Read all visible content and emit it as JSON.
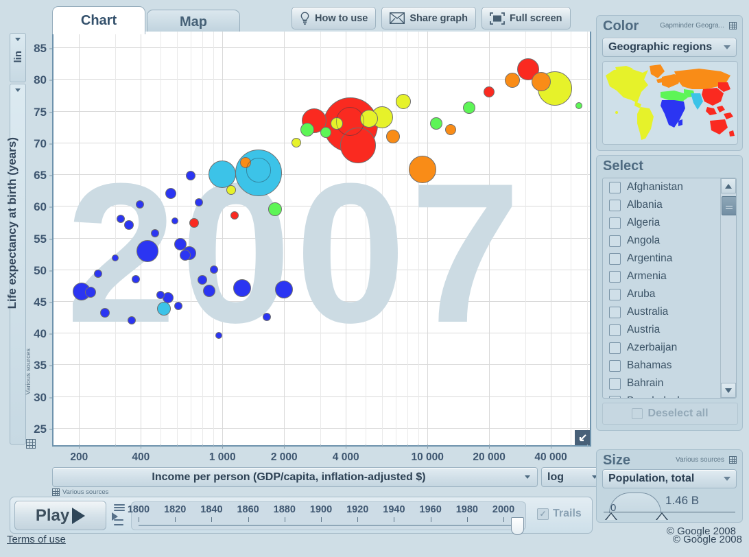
{
  "tabs": [
    {
      "label": "Chart",
      "active": true
    },
    {
      "label": "Map",
      "active": false
    }
  ],
  "toolbar": {
    "how_to_use": "How to use",
    "share_graph": "Share graph",
    "full_screen": "Full screen"
  },
  "chart_data": {
    "type": "scatter",
    "title": "2007",
    "watermark_year": "2007",
    "xlabel": "Income per person (GDP/capita, inflation-adjusted $)",
    "ylabel": "Life expectancy at birth (years)",
    "x_scale": "log",
    "y_scale": "lin",
    "x_tick_labels": [
      "200",
      "400",
      "1 000",
      "2 000",
      "4 000",
      "10 000",
      "20 000",
      "40 000"
    ],
    "x_tick_values": [
      200,
      400,
      1000,
      2000,
      4000,
      10000,
      20000,
      40000
    ],
    "y_tick_labels": [
      "85",
      "80",
      "75",
      "70",
      "65",
      "60",
      "55",
      "50",
      "45",
      "40",
      "35",
      "30",
      "25"
    ],
    "y_tick_values": [
      85,
      80,
      75,
      70,
      65,
      60,
      55,
      50,
      45,
      40,
      35,
      30,
      25
    ],
    "xlim": [
      150,
      62000
    ],
    "ylim": [
      22.5,
      87.5
    ],
    "grid": true,
    "legend": "none",
    "size_variable": "Population, total",
    "color_variable": "Geographic regions",
    "series": [
      {
        "name": "Sub-Saharan Africa",
        "color": "#2b35f2"
      },
      {
        "name": "South Asia",
        "color": "#3cc3e8"
      },
      {
        "name": "America",
        "color": "#e6f22a"
      },
      {
        "name": "East Asia & Pacific",
        "color": "#fa2a20"
      },
      {
        "name": "Europe & Central Asia",
        "color": "#f98c17"
      },
      {
        "name": "Middle East & North Africa",
        "color": "#5df556"
      }
    ],
    "points": [
      {
        "x": 205,
        "y": 46.5,
        "r": 13,
        "c": "#2b35f2"
      },
      {
        "x": 228,
        "y": 46.4,
        "r": 8,
        "c": "#2b35f2"
      },
      {
        "x": 248,
        "y": 49.3,
        "r": 6,
        "c": "#2b35f2"
      },
      {
        "x": 268,
        "y": 43.2,
        "r": 7,
        "c": "#2b35f2"
      },
      {
        "x": 300,
        "y": 51.8,
        "r": 5,
        "c": "#2b35f2"
      },
      {
        "x": 320,
        "y": 58.0,
        "r": 6,
        "c": "#2b35f2"
      },
      {
        "x": 350,
        "y": 57.0,
        "r": 7,
        "c": "#2b35f2"
      },
      {
        "x": 360,
        "y": 42.0,
        "r": 6,
        "c": "#2b35f2"
      },
      {
        "x": 378,
        "y": 48.5,
        "r": 6,
        "c": "#2b35f2"
      },
      {
        "x": 395,
        "y": 60.2,
        "r": 6,
        "c": "#2b35f2"
      },
      {
        "x": 430,
        "y": 52.9,
        "r": 16,
        "c": "#2b35f2"
      },
      {
        "x": 470,
        "y": 55.7,
        "r": 6,
        "c": "#2b35f2"
      },
      {
        "x": 500,
        "y": 46.0,
        "r": 6,
        "c": "#2b35f2"
      },
      {
        "x": 520,
        "y": 43.8,
        "r": 10,
        "c": "#3cc3e8"
      },
      {
        "x": 545,
        "y": 45.5,
        "r": 8,
        "c": "#2b35f2"
      },
      {
        "x": 560,
        "y": 62.0,
        "r": 8,
        "c": "#2b35f2"
      },
      {
        "x": 585,
        "y": 57.6,
        "r": 5,
        "c": "#2b35f2"
      },
      {
        "x": 610,
        "y": 44.2,
        "r": 6,
        "c": "#2b35f2"
      },
      {
        "x": 625,
        "y": 54.0,
        "r": 9,
        "c": "#2b35f2"
      },
      {
        "x": 660,
        "y": 52.2,
        "r": 8,
        "c": "#2b35f2"
      },
      {
        "x": 690,
        "y": 52.6,
        "r": 10,
        "c": "#2b35f2"
      },
      {
        "x": 700,
        "y": 64.8,
        "r": 7,
        "c": "#2b35f2"
      },
      {
        "x": 730,
        "y": 57.3,
        "r": 7,
        "c": "#fa2a20"
      },
      {
        "x": 770,
        "y": 60.6,
        "r": 6,
        "c": "#2b35f2"
      },
      {
        "x": 800,
        "y": 48.3,
        "r": 7,
        "c": "#2b35f2"
      },
      {
        "x": 860,
        "y": 46.6,
        "r": 9,
        "c": "#2b35f2"
      },
      {
        "x": 910,
        "y": 50.0,
        "r": 6,
        "c": "#2b35f2"
      },
      {
        "x": 960,
        "y": 39.6,
        "r": 5,
        "c": "#2b35f2"
      },
      {
        "x": 1000,
        "y": 65.0,
        "r": 20,
        "c": "#3cc3e8"
      },
      {
        "x": 1100,
        "y": 62.5,
        "r": 7,
        "c": "#e6f22a"
      },
      {
        "x": 1150,
        "y": 58.5,
        "r": 6,
        "c": "#fa2a20"
      },
      {
        "x": 1250,
        "y": 47.0,
        "r": 13,
        "c": "#2b35f2"
      },
      {
        "x": 1300,
        "y": 66.8,
        "r": 8,
        "c": "#f98c17"
      },
      {
        "x": 1500,
        "y": 65.2,
        "r": 34,
        "c": "#3cc3e8"
      },
      {
        "x": 1650,
        "y": 42.5,
        "r": 6,
        "c": "#2b35f2"
      },
      {
        "x": 1800,
        "y": 59.5,
        "r": 10,
        "c": "#5df556"
      },
      {
        "x": 2000,
        "y": 46.8,
        "r": 13,
        "c": "#2b35f2"
      },
      {
        "x": 2300,
        "y": 70.0,
        "r": 7,
        "c": "#e6f22a"
      },
      {
        "x": 2600,
        "y": 72.0,
        "r": 10,
        "c": "#5df556"
      },
      {
        "x": 2800,
        "y": 73.4,
        "r": 18,
        "c": "#fa2a20"
      },
      {
        "x": 3200,
        "y": 71.6,
        "r": 8,
        "c": "#5df556"
      },
      {
        "x": 3600,
        "y": 73.0,
        "r": 9,
        "c": "#e6f22a"
      },
      {
        "x": 4200,
        "y": 72.8,
        "r": 40,
        "c": "#fa2a20"
      },
      {
        "x": 4600,
        "y": 69.5,
        "r": 26,
        "c": "#fa2a20"
      },
      {
        "x": 5200,
        "y": 73.8,
        "r": 13,
        "c": "#e6f22a"
      },
      {
        "x": 6000,
        "y": 74.0,
        "r": 16,
        "c": "#e6f22a"
      },
      {
        "x": 6800,
        "y": 71.0,
        "r": 10,
        "c": "#f98c17"
      },
      {
        "x": 7600,
        "y": 76.5,
        "r": 11,
        "c": "#e6f22a"
      },
      {
        "x": 9500,
        "y": 65.8,
        "r": 20,
        "c": "#f98c17"
      },
      {
        "x": 11000,
        "y": 73.0,
        "r": 9,
        "c": "#5df556"
      },
      {
        "x": 13000,
        "y": 72.0,
        "r": 8,
        "c": "#f98c17"
      },
      {
        "x": 16000,
        "y": 75.5,
        "r": 9,
        "c": "#5df556"
      },
      {
        "x": 20000,
        "y": 78.0,
        "r": 8,
        "c": "#fa2a20"
      },
      {
        "x": 26000,
        "y": 79.8,
        "r": 11,
        "c": "#f98c17"
      },
      {
        "x": 31000,
        "y": 81.5,
        "r": 16,
        "c": "#fa2a20"
      },
      {
        "x": 36000,
        "y": 79.6,
        "r": 14,
        "c": "#f98c17"
      },
      {
        "x": 42000,
        "y": 78.5,
        "r": 25,
        "c": "#e6f22a"
      },
      {
        "x": 55000,
        "y": 75.8,
        "r": 5,
        "c": "#5df556"
      }
    ]
  },
  "yaxis": {
    "scale_button_label": "lin",
    "source_note": "Various sources"
  },
  "xaxis": {
    "selector_label": "Income per person (GDP/capita, inflation-adjusted $)",
    "scale_label": "log",
    "source_note": "Various sources"
  },
  "player": {
    "play_label": "Play",
    "trails_label": "Trails",
    "trails_checked": true,
    "year_labels": [
      "1800",
      "1820",
      "1840",
      "1860",
      "1880",
      "1900",
      "1920",
      "1940",
      "1960",
      "1980",
      "2000"
    ],
    "current_year": 2007,
    "range": [
      1800,
      2009
    ]
  },
  "color_panel": {
    "title": "Color",
    "source": "Gapminder Geogra...",
    "selected": "Geographic regions",
    "map_regions": [
      {
        "name": "america",
        "color": "#e6f22a"
      },
      {
        "name": "europe-central-asia",
        "color": "#f98c17"
      },
      {
        "name": "middle-east-north-africa",
        "color": "#5df556"
      },
      {
        "name": "sub-saharan-africa",
        "color": "#2b35f2"
      },
      {
        "name": "south-asia",
        "color": "#3cc3e8"
      },
      {
        "name": "east-asia-pacific",
        "color": "#fa2a20"
      }
    ]
  },
  "select_panel": {
    "title": "Select",
    "deselect_label": "Deselect all",
    "countries": [
      "Afghanistan",
      "Albania",
      "Algeria",
      "Angola",
      "Argentina",
      "Armenia",
      "Aruba",
      "Australia",
      "Austria",
      "Azerbaijan",
      "Bahamas",
      "Bahrain",
      "Bangladesh"
    ]
  },
  "size_panel": {
    "title": "Size",
    "source": "Various sources",
    "selected": "Population, total",
    "max_label": "1.46 B",
    "min_label": "0"
  },
  "footer": {
    "terms": "Terms of use",
    "copyright": "© Google 2008",
    "google_copy": "© Google 2008"
  }
}
